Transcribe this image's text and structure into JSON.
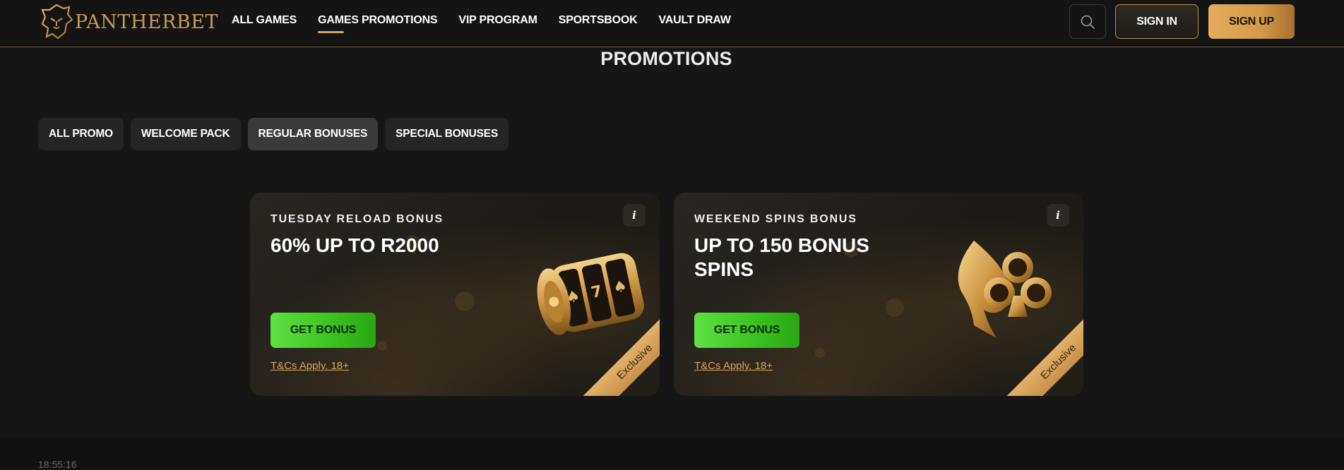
{
  "header": {
    "logo_text": "PANTHERBET",
    "nav": [
      {
        "label": "ALL GAMES"
      },
      {
        "label": "GAMES PROMOTIONS",
        "active": true
      },
      {
        "label": "VIP PROGRAM"
      },
      {
        "label": "SPORTSBOOK"
      },
      {
        "label": "VAULT DRAW"
      }
    ],
    "search_icon": "search-icon",
    "sign_in_label": "SIGN IN",
    "sign_up_label": "SIGN UP"
  },
  "page": {
    "title": "PROMOTIONS",
    "filters": [
      {
        "label": "ALL PROMO"
      },
      {
        "label": "WELCOME PACK"
      },
      {
        "label": "REGULAR BONUSES",
        "active": true
      },
      {
        "label": "SPECIAL BONUSES"
      }
    ]
  },
  "cards": [
    {
      "subtitle": "TUESDAY RELOAD BONUS",
      "title": "60% UP TO R2000",
      "button": "GET BONUS",
      "terms": "T&Cs Apply. 18+",
      "info": "i",
      "ribbon": "Exclusive",
      "art_icon": "slot-reel-icon"
    },
    {
      "subtitle": "WEEKEND SPINS BONUS",
      "title": "UP TO 150 BONUS SPINS",
      "button": "GET BONUS",
      "terms": "T&Cs Apply. 18+",
      "info": "i",
      "ribbon": "Exclusive",
      "art_icon": "spade-club-icon"
    }
  ],
  "footer": {
    "clock": "18:55:16"
  },
  "colors": {
    "accent_gold": "#d4a45a",
    "cta_green": "#39c21f",
    "background": "#161616"
  }
}
